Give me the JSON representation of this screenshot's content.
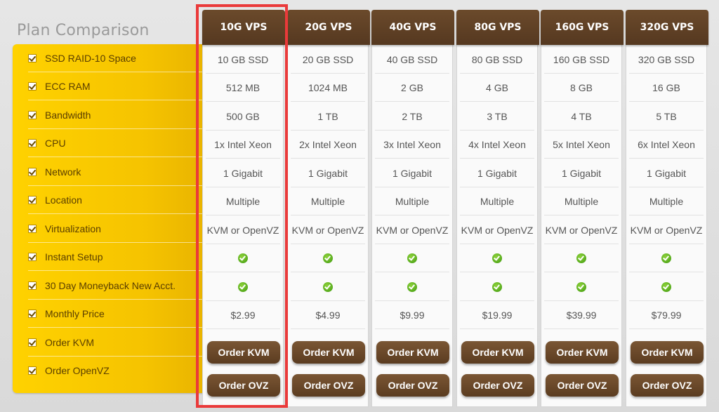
{
  "title": "Plan Comparison",
  "features": [
    "SSD RAID-10 Space",
    "ECC RAM",
    "Bandwidth",
    "CPU",
    "Network",
    "Location",
    "Virtualization",
    "Instant Setup",
    "30 Day Moneyback New Acct.",
    "Monthly Price",
    "Order KVM",
    "Order OpenVZ"
  ],
  "plans": [
    {
      "name": "10G VPS",
      "ssd": "10 GB SSD",
      "ram": "512 MB",
      "bandwidth": "500 GB",
      "cpu": "1x Intel Xeon",
      "network": "1 Gigabit",
      "location": "Multiple",
      "virtualization": "KVM or OpenVZ",
      "price": "$2.99",
      "order_kvm": "Order KVM",
      "order_ovz": "Order OVZ"
    },
    {
      "name": "20G VPS",
      "ssd": "20 GB SSD",
      "ram": "1024 MB",
      "bandwidth": "1 TB",
      "cpu": "2x Intel Xeon",
      "network": "1 Gigabit",
      "location": "Multiple",
      "virtualization": "KVM or OpenVZ",
      "price": "$4.99",
      "order_kvm": "Order KVM",
      "order_ovz": "Order OVZ"
    },
    {
      "name": "40G VPS",
      "ssd": "40 GB SSD",
      "ram": "2 GB",
      "bandwidth": "2 TB",
      "cpu": "3x Intel Xeon",
      "network": "1 Gigabit",
      "location": "Multiple",
      "virtualization": "KVM or OpenVZ",
      "price": "$9.99",
      "order_kvm": "Order KVM",
      "order_ovz": "Order OVZ"
    },
    {
      "name": "80G VPS",
      "ssd": "80 GB SSD",
      "ram": "4 GB",
      "bandwidth": "3 TB",
      "cpu": "4x Intel Xeon",
      "network": "1 Gigabit",
      "location": "Multiple",
      "virtualization": "KVM or OpenVZ",
      "price": "$19.99",
      "order_kvm": "Order KVM",
      "order_ovz": "Order OVZ"
    },
    {
      "name": "160G VPS",
      "ssd": "160 GB SSD",
      "ram": "8 GB",
      "bandwidth": "4 TB",
      "cpu": "5x Intel Xeon",
      "network": "1 Gigabit",
      "location": "Multiple",
      "virtualization": "KVM or OpenVZ",
      "price": "$39.99",
      "order_kvm": "Order KVM",
      "order_ovz": "Order OVZ"
    },
    {
      "name": "320G VPS",
      "ssd": "320 GB SSD",
      "ram": "16 GB",
      "bandwidth": "5 TB",
      "cpu": "6x Intel Xeon",
      "network": "1 Gigabit",
      "location": "Multiple",
      "virtualization": "KVM or OpenVZ",
      "price": "$79.99",
      "order_kvm": "Order KVM",
      "order_ovz": "Order OVZ"
    }
  ],
  "icons": {
    "feature_check": "checkbox-icon",
    "included": "check-circle-icon"
  },
  "colors": {
    "accent_yellow": "#ffd200",
    "header_brown": "#5b3c20",
    "highlight_red": "#ea3a3a",
    "ok_green": "#3f9a10"
  }
}
